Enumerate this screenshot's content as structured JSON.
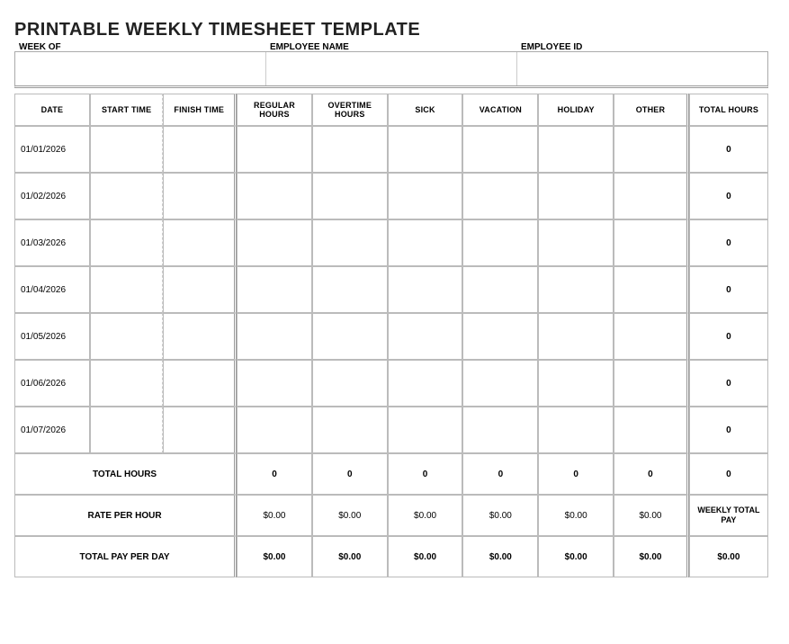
{
  "title": "PRINTABLE WEEKLY TIMESHEET TEMPLATE",
  "header": {
    "week_of_label": "WEEK OF",
    "employee_name_label": "EMPLOYEE NAME",
    "employee_id_label": "EMPLOYEE ID",
    "week_of": "",
    "employee_name": "",
    "employee_id": ""
  },
  "columns": {
    "date": "DATE",
    "start_time": "START TIME",
    "finish_time": "FINISH TIME",
    "regular": "REGULAR HOURS",
    "overtime": "OVERTIME HOURS",
    "sick": "SICK",
    "vacation": "VACATION",
    "holiday": "HOLIDAY",
    "other": "OTHER",
    "total": "TOTAL HOURS"
  },
  "rows": [
    {
      "date": "01/01/2026",
      "total": "0"
    },
    {
      "date": "01/02/2026",
      "total": "0"
    },
    {
      "date": "01/03/2026",
      "total": "0"
    },
    {
      "date": "01/04/2026",
      "total": "0"
    },
    {
      "date": "01/05/2026",
      "total": "0"
    },
    {
      "date": "01/06/2026",
      "total": "0"
    },
    {
      "date": "01/07/2026",
      "total": "0"
    }
  ],
  "summary": {
    "total_hours_label": "TOTAL HOURS",
    "rate_label": "RATE PER HOUR",
    "total_pay_label": "TOTAL PAY PER DAY",
    "weekly_total_pay_label": "WEEKLY TOTAL PAY",
    "total_hours": {
      "regular": "0",
      "overtime": "0",
      "sick": "0",
      "vacation": "0",
      "holiday": "0",
      "other": "0",
      "grand": "0"
    },
    "rate": {
      "regular": "$0.00",
      "overtime": "$0.00",
      "sick": "$0.00",
      "vacation": "$0.00",
      "holiday": "$0.00",
      "other": "$0.00"
    },
    "total_pay": {
      "regular": "$0.00",
      "overtime": "$0.00",
      "sick": "$0.00",
      "vacation": "$0.00",
      "holiday": "$0.00",
      "other": "$0.00",
      "grand": "$0.00"
    }
  }
}
